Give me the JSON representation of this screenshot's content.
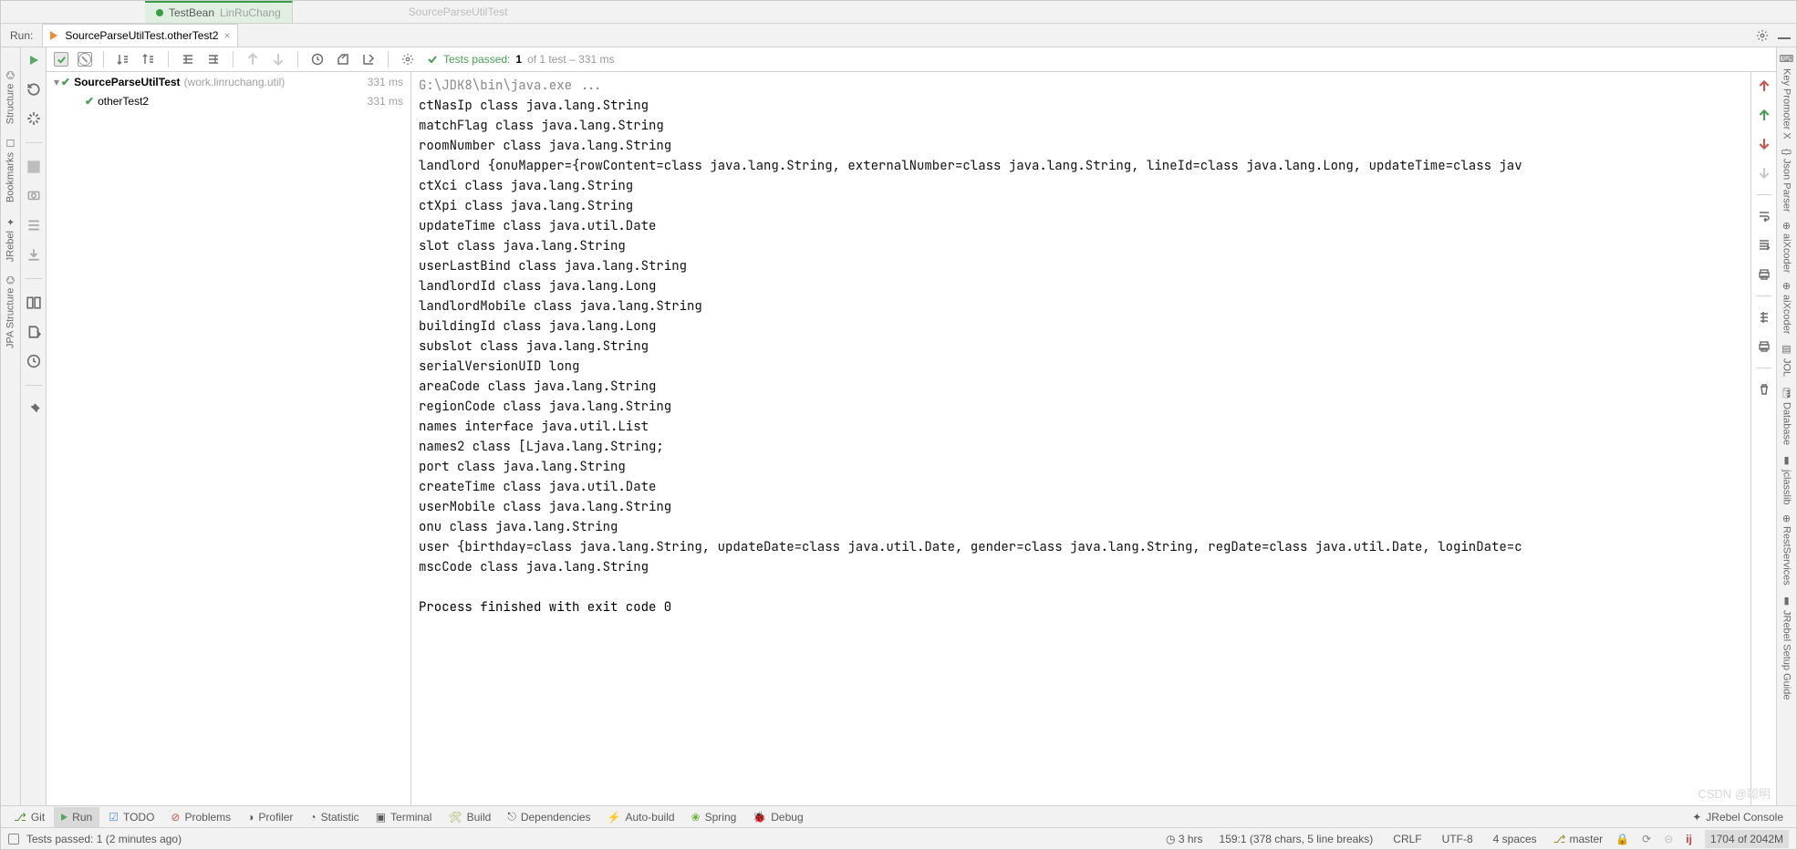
{
  "editor_tabs": {
    "left": {
      "label": "TestBean",
      "sublabel": "LinRuChang"
    },
    "right": {
      "label": "SourceParseUtilTest"
    }
  },
  "run_header": {
    "label": "Run:",
    "tab": "SourceParseUtilTest.otherTest2",
    "settings_tooltip": "Settings",
    "hide_tooltip": "Hide"
  },
  "toolbar": {
    "tests_prefix": "Tests passed:",
    "tests_count": "1",
    "tests_of": " of 1 test",
    "tests_time": " – 331 ms"
  },
  "tree": {
    "root": {
      "name": "SourceParseUtilTest",
      "location": "(work.linruchang.util)",
      "time": "331 ms"
    },
    "child": {
      "name": "otherTest2",
      "time": "331 ms"
    }
  },
  "console": {
    "cmd": "G:\\JDK8\\bin\\java.exe ...",
    "lines": [
      "ctNasIp class java.lang.String",
      "matchFlag class java.lang.String",
      "roomNumber class java.lang.String",
      "landlord {onuMapper={rowContent=class java.lang.String, externalNumber=class java.lang.String, lineId=class java.lang.Long, updateTime=class jav",
      "ctXci class java.lang.String",
      "ctXpi class java.lang.String",
      "updateTime class java.util.Date",
      "slot class java.lang.String",
      "userLastBind class java.lang.String",
      "landlordId class java.lang.Long",
      "landlordMobile class java.lang.String",
      "buildingId class java.lang.Long",
      "subslot class java.lang.String",
      "serialVersionUID long",
      "areaCode class java.lang.String",
      "regionCode class java.lang.String",
      "names interface java.util.List",
      "names2 class [Ljava.lang.String;",
      "port class java.lang.String",
      "createTime class java.util.Date",
      "userMobile class java.lang.String",
      "onu class java.lang.String",
      "user {birthday=class java.lang.String, updateDate=class java.util.Date, gender=class java.lang.String, regDate=class java.util.Date, loginDate=c",
      "mscCode class java.lang.String"
    ],
    "exit": "Process finished with exit code 0"
  },
  "left_stripe": [
    "Structure",
    "Bookmarks",
    "JRebel",
    "JPA Structure"
  ],
  "right_stripe": [
    "Key Promoter X",
    "Json Parser",
    "aiXcoder",
    "aiXcoder",
    "JOL",
    "Database",
    "jclasslib",
    "RestServices",
    "JRebel Setup Guide"
  ],
  "bottom_tabs": {
    "git": "Git",
    "run": "Run",
    "todo": "TODO",
    "problems": "Problems",
    "profiler": "Profiler",
    "statistic": "Statistic",
    "terminal": "Terminal",
    "build": "Build",
    "dependencies": "Dependencies",
    "autobuild": "Auto-build",
    "spring": "Spring",
    "debug": "Debug",
    "jrebel": "JRebel Console"
  },
  "status": {
    "msg": "Tests passed: 1 (2 minutes ago)",
    "time": "3 hrs",
    "caret": "159:1 (378 chars, 5 line breaks)",
    "eol": "CRLF",
    "enc": "UTF-8",
    "indent": "4 spaces",
    "branch": "master",
    "mem": "1704 of 2042M"
  },
  "watermark": "CSDN @聪明"
}
